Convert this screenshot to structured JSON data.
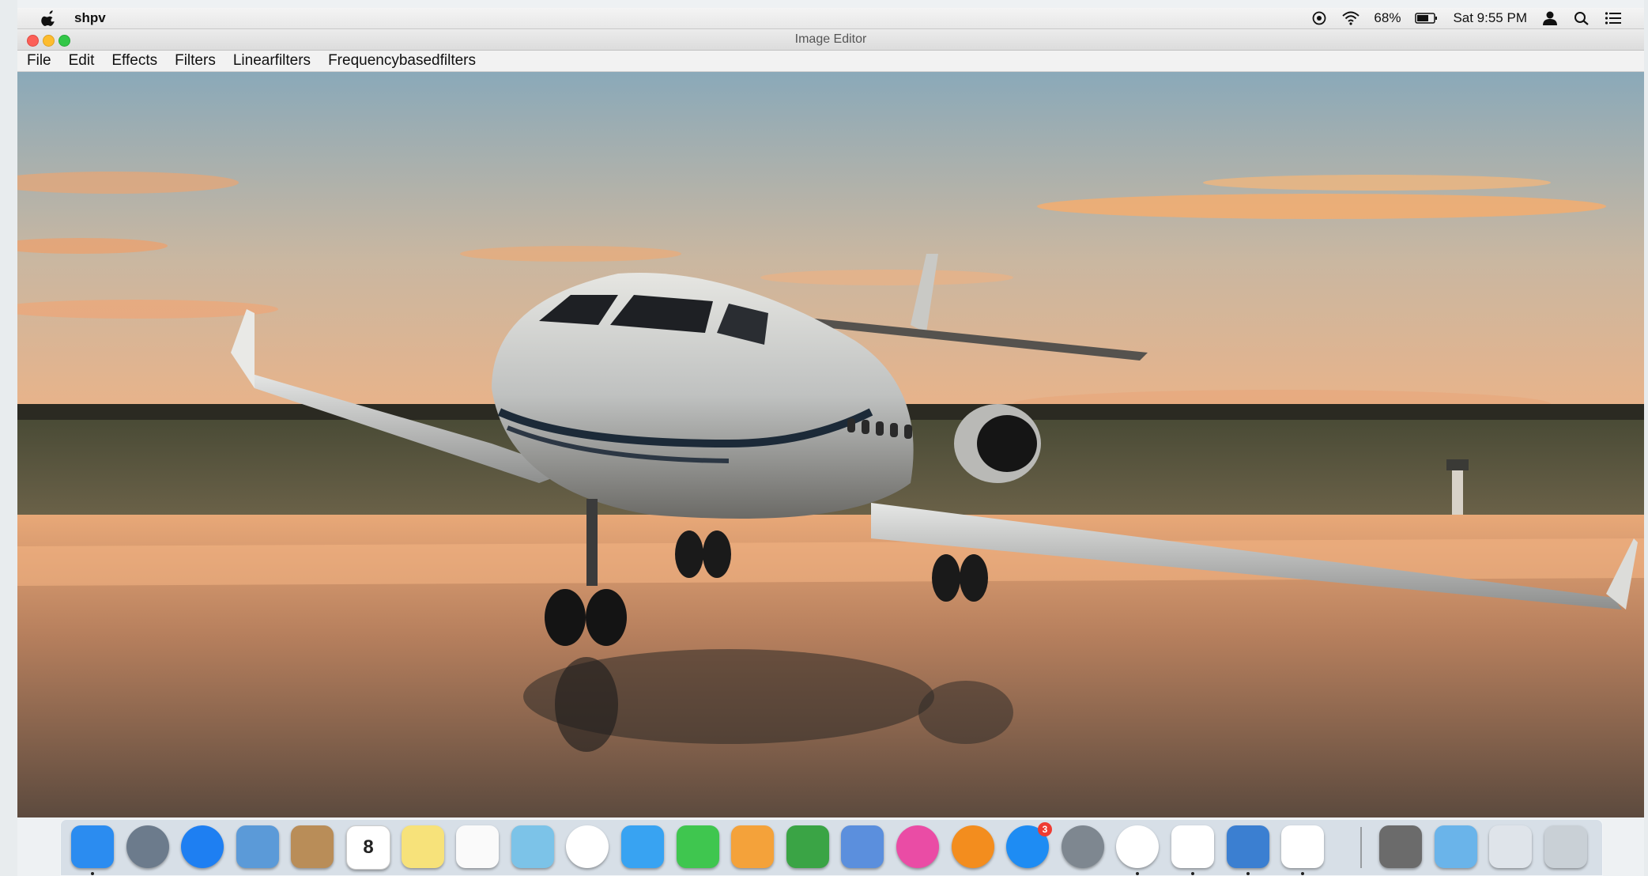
{
  "menubar": {
    "app_name": "shpv",
    "battery_percent": "68%",
    "clock": "Sat 9:55 PM",
    "icons": [
      "apple-icon",
      "siri-icon",
      "wifi-icon",
      "battery-icon",
      "user-icon",
      "spotlight-icon",
      "notification-center-icon"
    ]
  },
  "window": {
    "title": "Image Editor"
  },
  "app_menu": {
    "items": [
      "File",
      "Edit",
      "Effects",
      "Filters",
      "Linearfilters",
      "Frequencybasedfilters"
    ]
  },
  "canvas": {
    "content": "photo-jet-sunset"
  },
  "dock": {
    "apps": [
      {
        "icon": "finder-icon",
        "color": "#2b8cf0",
        "running": true
      },
      {
        "icon": "launchpad-icon",
        "color": "#6c7b8c",
        "running": false
      },
      {
        "icon": "safari-icon",
        "color": "#1e7ff2",
        "running": false
      },
      {
        "icon": "mail-icon",
        "color": "#5b9ad8",
        "running": false
      },
      {
        "icon": "contacts-icon",
        "color": "#b98d58",
        "running": false
      },
      {
        "icon": "calendar-icon",
        "color": "#ffffff",
        "running": false,
        "label": "8"
      },
      {
        "icon": "notes-icon",
        "color": "#f7e27a",
        "running": false
      },
      {
        "icon": "reminders-icon",
        "color": "#fafafa",
        "running": false
      },
      {
        "icon": "maps-icon",
        "color": "#7cc3e8",
        "running": false
      },
      {
        "icon": "photos-icon",
        "color": "#ffffff",
        "running": false
      },
      {
        "icon": "messages-icon",
        "color": "#38a3f2",
        "running": false
      },
      {
        "icon": "facetime-icon",
        "color": "#3fc64f",
        "running": false
      },
      {
        "icon": "pages-icon",
        "color": "#f4a23a",
        "running": false
      },
      {
        "icon": "numbers-icon",
        "color": "#3aa445",
        "running": false
      },
      {
        "icon": "keynote-icon",
        "color": "#5b8fdd",
        "running": false
      },
      {
        "icon": "itunes-icon",
        "color": "#ea4ca5",
        "running": false
      },
      {
        "icon": "ibooks-icon",
        "color": "#f38d1e",
        "running": false
      },
      {
        "icon": "app-store-icon",
        "color": "#1e8cf3",
        "running": false,
        "badge": "3"
      },
      {
        "icon": "system-preferences-icon",
        "color": "#7e8790",
        "running": false
      },
      {
        "icon": "chrome-icon",
        "color": "#ffffff",
        "running": true
      },
      {
        "icon": "acrobat-icon",
        "color": "#ffffff",
        "running": true
      },
      {
        "icon": "virtualbox-icon",
        "color": "#3b7fd1",
        "running": true
      },
      {
        "icon": "java-icon",
        "color": "#ffffff",
        "running": true
      }
    ],
    "stacks": [
      {
        "icon": "photo-stack-icon",
        "color": "#6b6b6b"
      },
      {
        "icon": "folder-icon",
        "color": "#6ab4ea"
      },
      {
        "icon": "downloads-stack-icon",
        "color": "#dfe4ea"
      },
      {
        "icon": "trash-icon",
        "color": "#c9d0d6"
      }
    ]
  }
}
